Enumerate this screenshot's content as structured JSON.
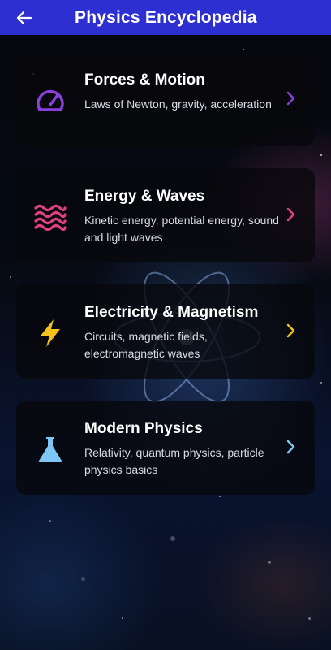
{
  "app_bar": {
    "title": "Physics Encyclopedia",
    "back_icon": "arrow-left-icon",
    "background": "#2e2fd0"
  },
  "topics": [
    {
      "title": "Forces & Motion",
      "description": "Laws of Newton, gravity, acceleration",
      "icon": "speedometer-icon",
      "accent": "#8b3fe0"
    },
    {
      "title": "Energy & Waves",
      "description": "Kinetic energy, potential energy, sound and light waves",
      "icon": "waves-icon",
      "accent": "#e0407e"
    },
    {
      "title": "Electricity & Magnetism",
      "description": "Circuits, magnetic fields, electromagnetic waves",
      "icon": "lightning-bolt-icon",
      "accent": "#f6c21a"
    },
    {
      "title": "Modern Physics",
      "description": "Relativity, quantum physics, particle physics basics",
      "icon": "flask-icon",
      "accent": "#7ec6f5"
    }
  ]
}
